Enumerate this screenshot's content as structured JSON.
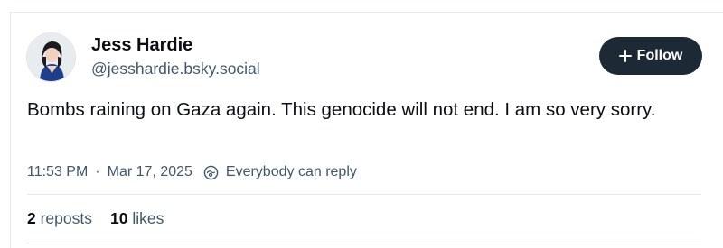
{
  "author": {
    "display_name": "Jess Hardie",
    "handle": "@jesshardie.bsky.social"
  },
  "follow_button": {
    "label": "Follow",
    "icon": "plus-icon"
  },
  "post": {
    "text": "Bombs raining on Gaza again. This genocide will not end. I am so very sorry.",
    "time": "11:53 PM",
    "separator": "·",
    "date": "Mar 17, 2025",
    "reply_setting": "Everybody can reply",
    "reply_icon": "globe-reply-icon"
  },
  "stats": {
    "reposts_count": "2",
    "reposts_label": "reposts",
    "likes_count": "10",
    "likes_label": "likes"
  },
  "colors": {
    "follow_button_bg": "#1e2936",
    "muted_text": "#42576c",
    "divider": "#e6e9ee"
  }
}
